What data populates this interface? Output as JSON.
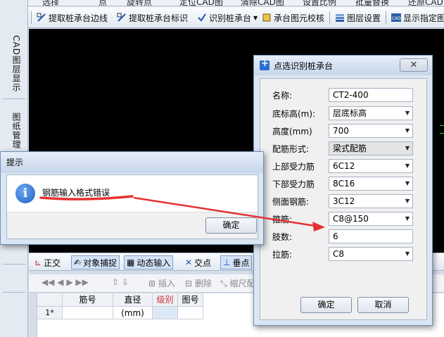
{
  "toolbar_top": [
    "选择",
    "点",
    "旋转点",
    "定位CAD图",
    "清除CAD图",
    "设置比例",
    "批量替换",
    "还原CAD"
  ],
  "toolbar": {
    "items": [
      "提取桩承台边线",
      "提取桩承台标识",
      "识别桩承台",
      "承台图元校核",
      "图层设置",
      "显示指定图"
    ]
  },
  "left_tabs": [
    "CAD图层显示",
    "图纸管理"
  ],
  "bottom_toolbar": [
    "正交",
    "对象捕捉",
    "动态输入",
    "交点",
    "垂点"
  ],
  "bottom_toolbar2": [
    "插入",
    "删除",
    "缩尺配"
  ],
  "grid": {
    "columns": [
      "筋号",
      "直径(mm)",
      "级别",
      "图号"
    ],
    "row_label": "1*"
  },
  "dialog": {
    "title": "点选识别桩承台",
    "fields": [
      {
        "label": "名称:",
        "value": "CT2-400",
        "dropdown": false
      },
      {
        "label": "底标高(m):",
        "value": "层底标高",
        "dropdown": true
      },
      {
        "label": "高度(mm)",
        "value": "700",
        "dropdown": true
      },
      {
        "label": "配筋形式:",
        "value": "梁式配筋",
        "dropdown": true
      },
      {
        "label": "上部受力筋",
        "value": "6C12",
        "dropdown": true
      },
      {
        "label": "下部受力筋",
        "value": "8C16",
        "dropdown": true
      },
      {
        "label": "侧面钢筋:",
        "value": "3C12",
        "dropdown": true
      },
      {
        "label": "箍筋:",
        "value": "C8@150",
        "dropdown": true
      },
      {
        "label": "肢数:",
        "value": "6",
        "dropdown": false
      },
      {
        "label": "拉筋:",
        "value": "C8",
        "dropdown": true
      }
    ],
    "ok_label": "确定",
    "cancel_label": "取消",
    "close_label": "✕"
  },
  "message": {
    "title": "提示",
    "text": "钢筋输入格式错误",
    "ok_label": "确定"
  },
  "colors": {
    "annotation": "#e63232",
    "canvas": "#000000"
  }
}
